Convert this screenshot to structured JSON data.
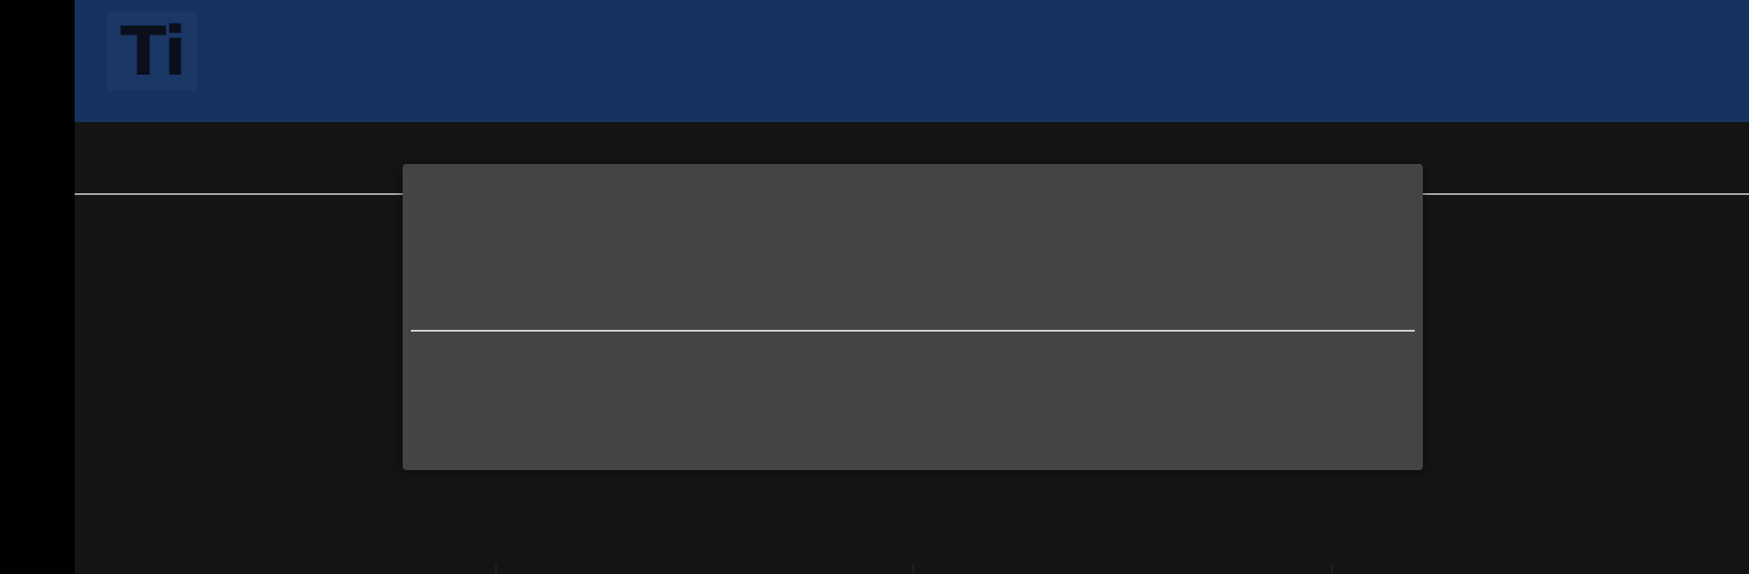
{
  "app": {
    "logo_text": "Ti"
  },
  "colors": {
    "header_bg": "#17325f",
    "app_bg": "#141414",
    "modal_bg": "#444444",
    "divider": "#d2d2d2"
  },
  "icons": {
    "logo": "app-logo-icon"
  }
}
